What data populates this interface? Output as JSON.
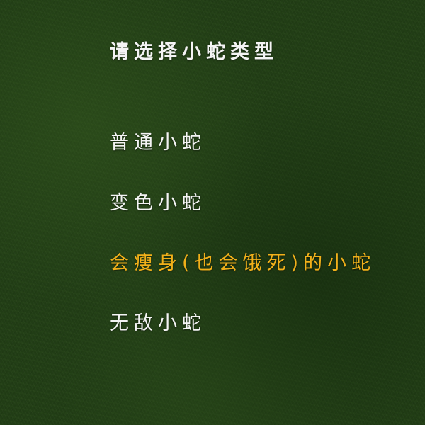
{
  "menu": {
    "title": "请选择小蛇类型",
    "options": [
      {
        "label": "普通小蛇",
        "selected": false
      },
      {
        "label": "变色小蛇",
        "selected": false
      },
      {
        "label": "会瘦身(也会饿死)的小蛇",
        "selected": true
      },
      {
        "label": "无敌小蛇",
        "selected": false
      }
    ]
  },
  "colors": {
    "text": "#f4f4f4",
    "highlight": "#f1b01a",
    "background": "#213d15"
  }
}
